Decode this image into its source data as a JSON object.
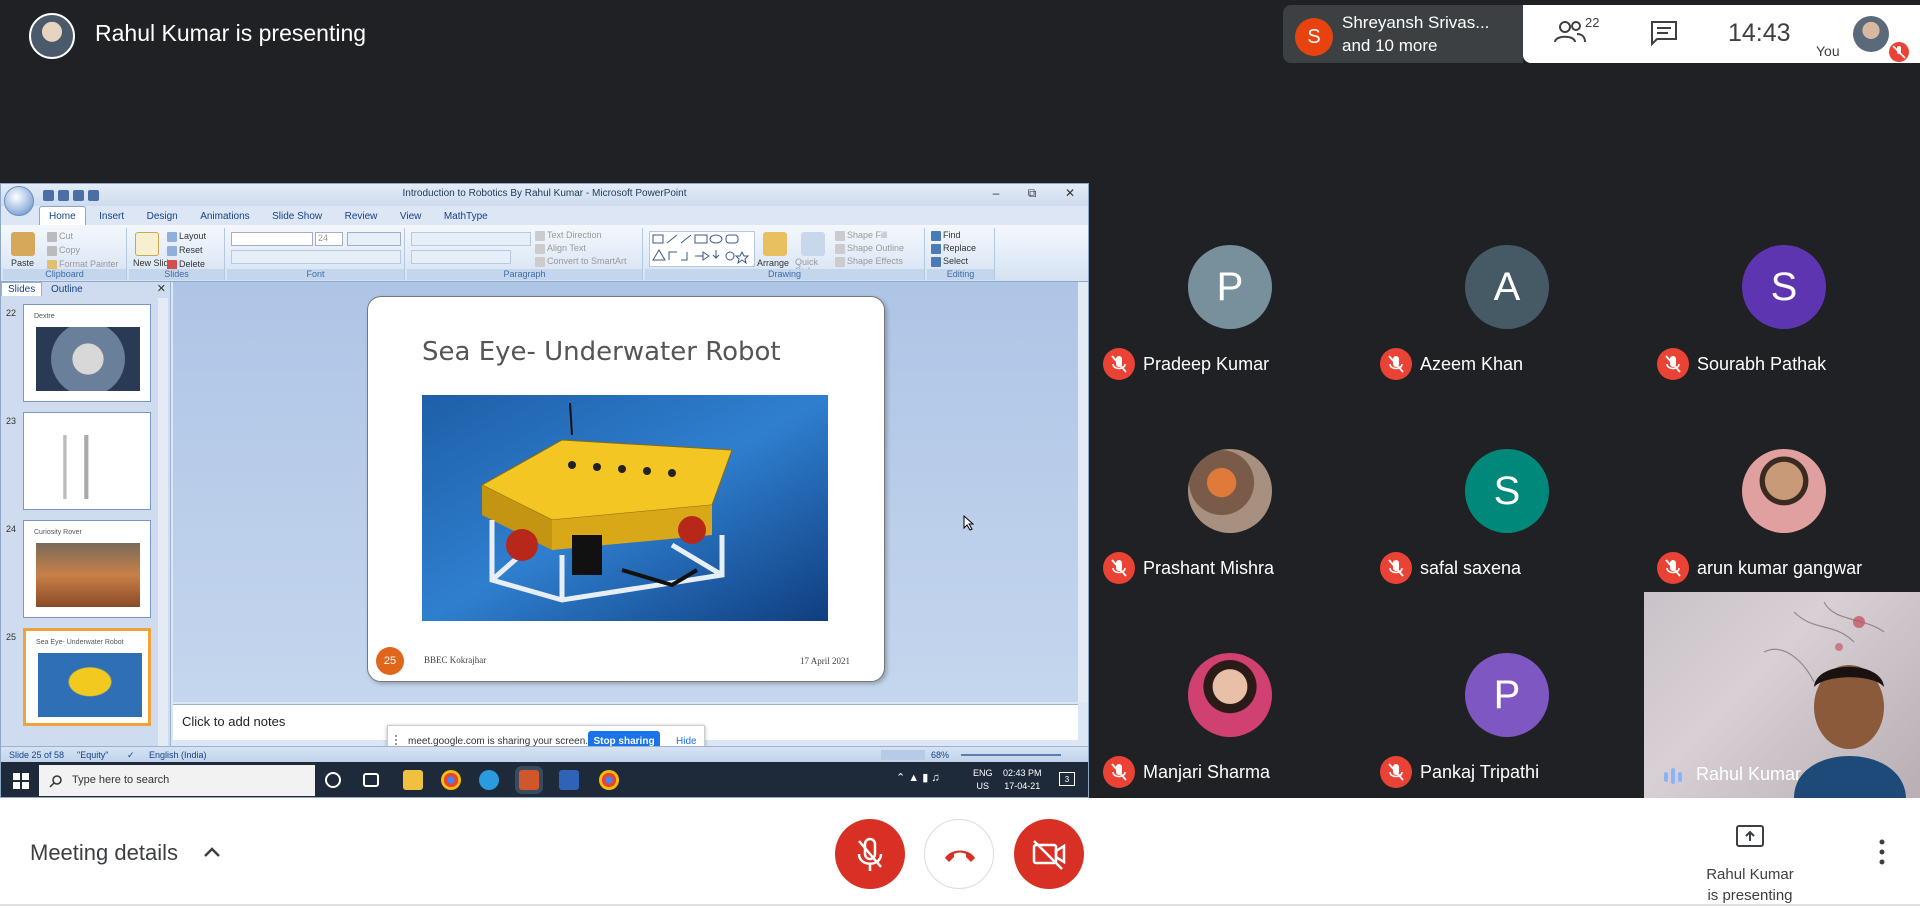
{
  "meet": {
    "presenting_title": "Rahul Kumar is presenting",
    "overflow_avatar_letter": "S",
    "overflow_line1": "Shreyansh Srivas...",
    "overflow_line2": "and 10 more",
    "people_count": "22",
    "clock": "14:43",
    "you_label": "You"
  },
  "ppt": {
    "window_title": "Introduction to Robotics By Rahul Kumar - Microsoft PowerPoint",
    "tabs": [
      "Home",
      "Insert",
      "Design",
      "Animations",
      "Slide Show",
      "Review",
      "View",
      "MathType"
    ],
    "groups": {
      "clipboard": "Clipboard",
      "slides": "Slides",
      "font": "Font",
      "paragraph": "Paragraph",
      "drawing": "Drawing",
      "editing": "Editing"
    },
    "buttons": {
      "paste": "Paste",
      "cut": "Cut",
      "copy": "Copy",
      "format_painter": "Format Painter",
      "new_slide": "New Slide",
      "layout": "Layout",
      "reset": "Reset",
      "delete": "Delete",
      "font_size": "24",
      "text_direction": "Text Direction",
      "align_text": "Align Text",
      "convert_smartart": "Convert to SmartArt",
      "arrange": "Arrange",
      "quick_styles": "Quick Styles",
      "shape_fill": "Shape Fill",
      "shape_outline": "Shape Outline",
      "shape_effects": "Shape Effects",
      "find": "Find",
      "replace": "Replace",
      "select": "Select"
    },
    "pane_tabs": [
      "Slides",
      "Outline"
    ],
    "thumbnails": [
      {
        "num": "22",
        "title": "Dextre"
      },
      {
        "num": "23",
        "title": ""
      },
      {
        "num": "24",
        "title": "Curiosity Rover"
      },
      {
        "num": "25",
        "title": "Sea Eye- Underwater Robot"
      }
    ],
    "slide": {
      "title": "Sea Eye- Underwater Robot",
      "number": "25",
      "footer": "BBEC Kokrajhar",
      "date": "17 April 2021"
    },
    "notes_placeholder": "Click to add notes",
    "share_bar": {
      "text": "meet.google.com is sharing your screen.",
      "stop": "Stop sharing",
      "hide": "Hide"
    },
    "status": {
      "slide_of": "Slide 25 of 58",
      "theme": "\"Equity\"",
      "language": "English (India)",
      "zoom": "68%"
    },
    "taskbar": {
      "search_placeholder": "Type here to search",
      "lang1": "ENG",
      "lang2": "US",
      "time": "02:43 PM",
      "date": "17-04-21",
      "notif_count": "3"
    }
  },
  "participants": [
    {
      "name": "Pradeep Kumar",
      "letter": "P",
      "color": "#78909c",
      "photo": false
    },
    {
      "name": "Azeem Khan",
      "letter": "A",
      "color": "#455a64",
      "photo": false
    },
    {
      "name": "Sourabh Pathak",
      "letter": "S",
      "color": "#5e35b1",
      "photo": false
    },
    {
      "name": "Prashant Mishra",
      "letter": "",
      "color": "#8d6e63",
      "photo": true
    },
    {
      "name": "safal saxena",
      "letter": "S",
      "color": "#00897b",
      "photo": false
    },
    {
      "name": "arun kumar gangwar",
      "letter": "",
      "color": "#bca58e",
      "photo": true
    },
    {
      "name": "Manjari Sharma",
      "letter": "",
      "color": "#c2185b",
      "photo": true
    },
    {
      "name": "Pankaj Tripathi",
      "letter": "P",
      "color": "#7e57c2",
      "photo": false
    }
  ],
  "self_tile": {
    "name": "Rahul Kumar"
  },
  "bottom": {
    "meeting_details": "Meeting details",
    "present_line1": "Rahul Kumar",
    "present_line2": "is presenting"
  },
  "colors": {
    "meet_bg": "#202124",
    "mic_off_red": "#ea4335",
    "accent_blue": "#1a73e8",
    "slide_number_orange": "#e0661c"
  }
}
